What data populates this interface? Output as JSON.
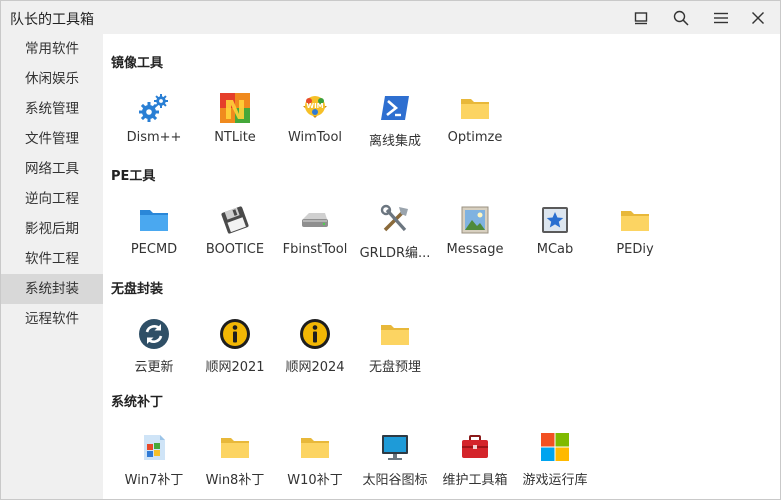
{
  "window": {
    "title": "队长的工具箱"
  },
  "titlebar_icons": [
    "minimize-icon",
    "search-icon",
    "menu-icon",
    "close-icon"
  ],
  "sidebar": {
    "items": [
      {
        "label": "常用软件"
      },
      {
        "label": "休闲娱乐"
      },
      {
        "label": "系统管理"
      },
      {
        "label": "文件管理"
      },
      {
        "label": "网络工具"
      },
      {
        "label": "逆向工程"
      },
      {
        "label": "影视后期"
      },
      {
        "label": "软件工程"
      },
      {
        "label": "系统封装",
        "active": true
      },
      {
        "label": "远程软件"
      }
    ]
  },
  "sections": [
    {
      "title": "镜像工具",
      "items": [
        {
          "label": "Dism++",
          "icon": "gears-icon"
        },
        {
          "label": "NTLite",
          "icon": "ntlite-icon"
        },
        {
          "label": "WimTool",
          "icon": "wimtool-icon"
        },
        {
          "label": "离线集成",
          "icon": "powershell-icon"
        },
        {
          "label": "Optimze",
          "icon": "folder-icon"
        }
      ]
    },
    {
      "title": "PE工具",
      "items": [
        {
          "label": "PECMD",
          "icon": "blue-folder-icon"
        },
        {
          "label": "BOOTICE",
          "icon": "floppy-disk-icon"
        },
        {
          "label": "FbinstTool",
          "icon": "hard-drive-icon"
        },
        {
          "label": "GRLDR编...",
          "icon": "tools-icon"
        },
        {
          "label": "Message",
          "icon": "picture-icon"
        },
        {
          "label": "MCab",
          "icon": "star-window-icon"
        },
        {
          "label": "PEDiy",
          "icon": "folder-icon"
        }
      ]
    },
    {
      "title": "无盘封装",
      "items": [
        {
          "label": "云更新",
          "icon": "refresh-icon"
        },
        {
          "label": "顺网2021",
          "icon": "info-badge-icon"
        },
        {
          "label": "顺网2024",
          "icon": "info-badge-icon"
        },
        {
          "label": "无盘预埋",
          "icon": "folder-icon"
        }
      ]
    },
    {
      "title": "系统补丁",
      "items": [
        {
          "label": "Win7补丁",
          "icon": "win7-patch-icon"
        },
        {
          "label": "Win8补丁",
          "icon": "folder-icon"
        },
        {
          "label": "W10补丁",
          "icon": "folder-icon"
        },
        {
          "label": "太阳谷图标",
          "icon": "monitor-icon"
        },
        {
          "label": "维护工具箱",
          "icon": "toolbox-icon"
        },
        {
          "label": "游戏运行库",
          "icon": "windows-logo-icon"
        }
      ]
    }
  ]
}
